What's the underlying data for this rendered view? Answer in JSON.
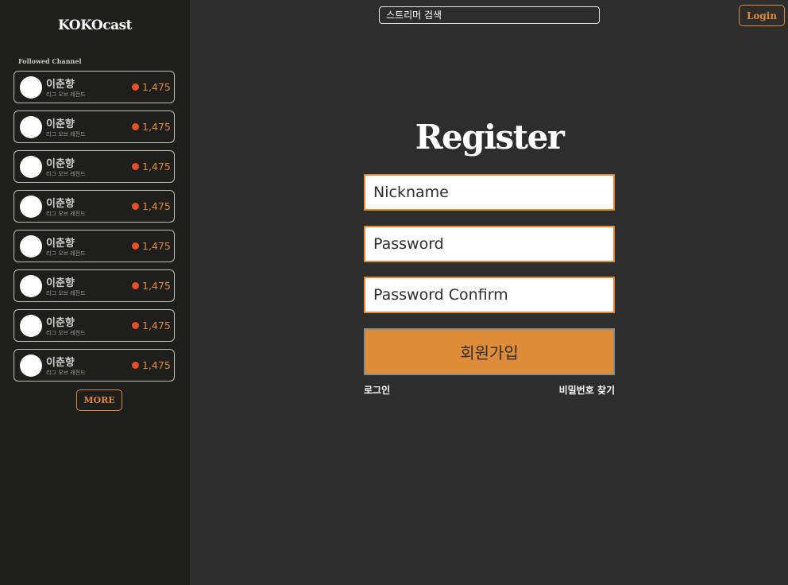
{
  "app": {
    "logo": "KOKOcast"
  },
  "header": {
    "search_value": "스트리머 검색",
    "login_label": "Login"
  },
  "sidebar": {
    "section_title": "Followed Channel",
    "channels": [
      {
        "name": "이춘향",
        "game": "리그 오브 레전드",
        "viewers": "1,475"
      },
      {
        "name": "이춘향",
        "game": "리그 오브 레전드",
        "viewers": "1,475"
      },
      {
        "name": "이춘향",
        "game": "리그 오브 레전드",
        "viewers": "1,475"
      },
      {
        "name": "이춘향",
        "game": "리그 오브 레전드",
        "viewers": "1,475"
      },
      {
        "name": "이춘향",
        "game": "리그 오브 레전드",
        "viewers": "1,475"
      },
      {
        "name": "이춘향",
        "game": "리그 오브 레전드",
        "viewers": "1,475"
      },
      {
        "name": "이춘향",
        "game": "리그 오브 레전드",
        "viewers": "1,475"
      },
      {
        "name": "이춘향",
        "game": "리그 오브 레전드",
        "viewers": "1,475"
      }
    ],
    "more_label": "MORE"
  },
  "register": {
    "title": "Register",
    "nickname_placeholder": "Nickname",
    "password_placeholder": "Password",
    "password_confirm_placeholder": "Password Confirm",
    "submit_label": "회원가입",
    "login_link": "로그인",
    "find_password_link": "비밀번호 찾기"
  },
  "colors": {
    "accent": "#e38a3a",
    "submit_bg": "#df8c3a",
    "live_dot": "#e94e2a",
    "sidebar_bg": "#1e1e1d",
    "main_bg": "#2d2d2d"
  }
}
